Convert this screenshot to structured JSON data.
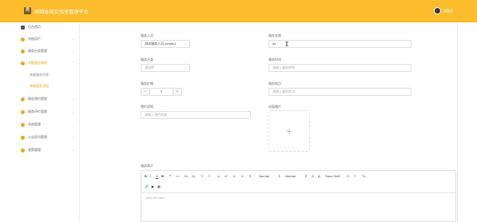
{
  "header": {
    "title": "国网体能实验室管理平台",
    "logo_glyph": "菁",
    "user_name": "管理员",
    "accent": "#fbbd2b"
  },
  "sidebar": {
    "items": [
      {
        "label": "后台首页",
        "icon": "home-icon"
      },
      {
        "label": "系统用户",
        "icon": "user-icon"
      },
      {
        "label": "服务分类管理",
        "icon": "category-icon"
      },
      {
        "label": "体能服务管理",
        "icon": "service-icon"
      },
      {
        "label": "服务预约管理",
        "icon": "reserve-icon"
      },
      {
        "label": "服务评价管理",
        "icon": "comment-icon"
      },
      {
        "label": "系统管理",
        "icon": "settings-icon"
      },
      {
        "label": "公告资讯管理",
        "icon": "notice-icon"
      },
      {
        "label": "政策管理",
        "icon": "policy-icon"
      }
    ],
    "subitems": [
      {
        "label": "体能服务列表"
      },
      {
        "label": "体能服务添加"
      }
    ]
  },
  "form": {
    "provider_label": "服务人员",
    "provider_value": "测试服务人员 yongfu1",
    "name_label": "服务名称",
    "name_value": "sd",
    "category_label": "服务分类",
    "category_value": "请选择",
    "time_label": "服务时间",
    "time_placeholder": "请输入服务时间",
    "price_label": "服务价格",
    "price_value": "0",
    "minus": "−",
    "plus": "+",
    "location_label": "服务地点",
    "location_placeholder": "请输入服务地点",
    "notice_label": "预约须知",
    "notice_placeholder": "请输入预约须知",
    "image_label": "封面图片",
    "upload_plus": "+",
    "detail_label": "服务简介",
    "editor_placeholder": "Insert text here ..."
  },
  "toolbar": {
    "items": [
      "B",
      "I",
      "U",
      "S",
      "❝",
      "<>",
      "H₁",
      "H₂",
      "≡",
      "≡",
      "x₂",
      "x²",
      "⇤",
      "⇥",
      "¶",
      "Normal",
      "⇕",
      "Normal",
      "⇕",
      "A",
      "A̲",
      "Sans Serif",
      "⇕",
      "≡",
      "Tx",
      "🔗",
      "▣",
      "▦"
    ]
  }
}
